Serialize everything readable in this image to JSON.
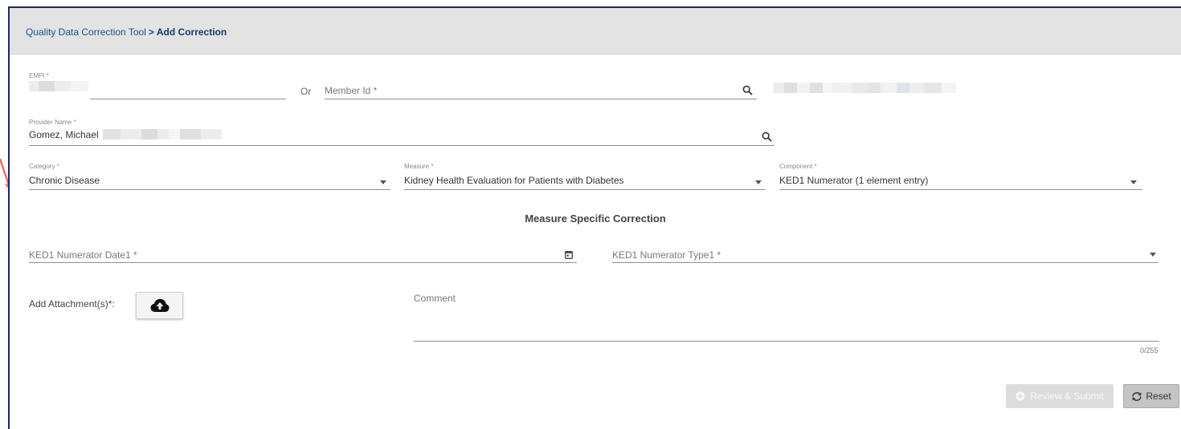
{
  "breadcrumb": {
    "root": "Quality Data Correction Tool",
    "separator": ">",
    "current": "Add Correction"
  },
  "empi": {
    "label": "EMPI *",
    "value": ""
  },
  "or_text": "Or",
  "member_id": {
    "placeholder": "Member Id *",
    "icon": "search-icon"
  },
  "provider": {
    "label": "Provider Name *",
    "value": "Gomez, Michael",
    "icon": "search-icon"
  },
  "category": {
    "label": "Category *",
    "value": "Chronic Disease",
    "icon": "chevron-down-icon"
  },
  "measure": {
    "label": "Measure *",
    "value": "Kidney Health Evaluation for Patients with Diabetes",
    "icon": "chevron-down-icon"
  },
  "component": {
    "label": "Component *",
    "value": "KED1 Numerator (1 element entry)",
    "icon": "chevron-down-icon"
  },
  "section_title": "Measure Specific Correction",
  "numerator_date": {
    "placeholder": "KED1 Numerator Date1 *",
    "icon": "calendar-icon"
  },
  "numerator_type": {
    "placeholder": "KED1 Numerator Type1 *",
    "icon": "chevron-down-icon"
  },
  "attachment": {
    "label": "Add Attachment(s)*:",
    "icon": "cloud-upload-icon"
  },
  "comment": {
    "placeholder": "Comment",
    "counter": "0/255"
  },
  "actions": {
    "review_label": "Review & Submit",
    "reset_label": "Reset"
  },
  "colors": {
    "header_bg": "#e3e3e3",
    "link": "#1a4f8a",
    "frame_border": "#1f2a5c",
    "annotation_arrow": "#f07060"
  }
}
